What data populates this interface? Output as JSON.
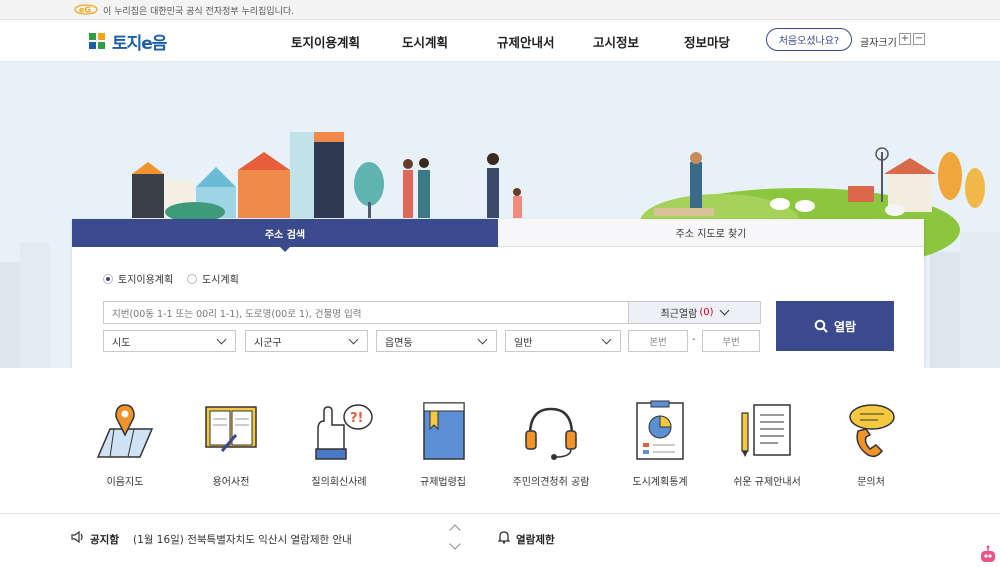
{
  "gov_banner": {
    "text": "이 누리집은 대한민국 공식 전자정부 누리집입니다."
  },
  "header": {
    "logo_text": "토지e음",
    "nav": [
      "토지이용계획",
      "도시계획",
      "규제안내서",
      "고시정보",
      "정보마당"
    ],
    "first_visit_button": "처음오셨나요?",
    "font_size_label": "글자크기",
    "font_plus": "+",
    "font_minus": "−"
  },
  "search": {
    "tabs": [
      "주소 검색",
      "주소 지도로 찾기"
    ],
    "active_tab": 0,
    "radios": [
      {
        "label": "토지이용계획",
        "checked": true
      },
      {
        "label": "도시계획",
        "checked": false
      }
    ],
    "address_placeholder": "지번(00동 1-1 또는 00리 1-1), 도로명(00로 1), 건물명 입력",
    "recent_label": "최근열람",
    "recent_count": "(0)",
    "selects": [
      "시도",
      "시군구",
      "읍면동",
      "일반"
    ],
    "bon_placeholder": "본번",
    "dash": "-",
    "bu_placeholder": "부번",
    "view_button": "열람"
  },
  "quick_menu": [
    {
      "label": "이음지도",
      "icon": "map-pin-icon"
    },
    {
      "label": "용어사전",
      "icon": "open-book-icon"
    },
    {
      "label": "질의회신사례",
      "icon": "question-hand-icon"
    },
    {
      "label": "규제법령집",
      "icon": "law-book-icon"
    },
    {
      "label": "주민의견청취 공람",
      "icon": "headset-icon"
    },
    {
      "label": "도시계획통계",
      "icon": "pie-chart-icon"
    },
    {
      "label": "쉬운 규제안내서",
      "icon": "document-pencil-icon"
    },
    {
      "label": "문의처",
      "icon": "phone-bubble-icon"
    }
  ],
  "notice": {
    "title": "공지함",
    "message": "(1월 16일) 전북특별자치도 익산시 열람제한 안내",
    "limit_title": "열람제한"
  },
  "colors": {
    "primary": "#3a4a8c",
    "logo_blue": "#1c5fa8",
    "hero_bg": "#e9f1f8",
    "alert": "#d0021b"
  }
}
